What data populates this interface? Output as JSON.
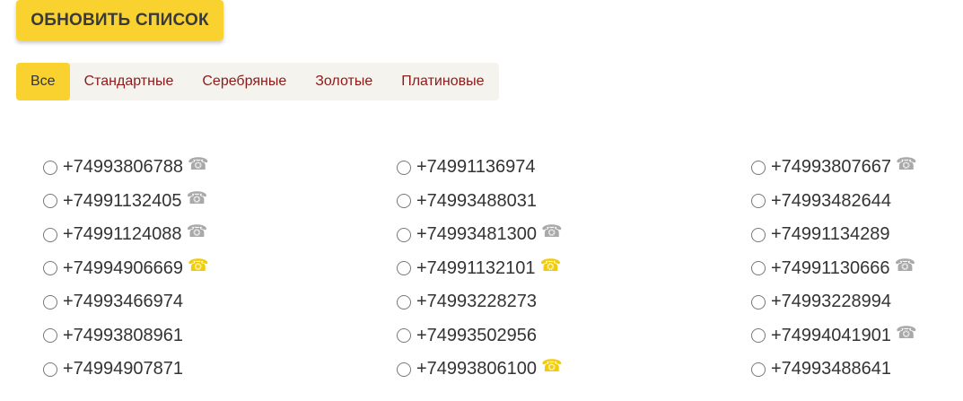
{
  "refresh_button": {
    "label": "ОБНОВИТЬ СПИСОК"
  },
  "tabs": [
    {
      "label": "Все",
      "active": true
    },
    {
      "label": "Стандартные",
      "active": false
    },
    {
      "label": "Серебряные",
      "active": false
    },
    {
      "label": "Золотые",
      "active": false
    },
    {
      "label": "Платиновые",
      "active": false
    }
  ],
  "colors": {
    "accent": "#f9d230",
    "tab_text": "#8b1a1a",
    "icon_gray": "#a9a9a9",
    "icon_gold": "#f2cc0b"
  },
  "icons": {
    "phone": "phone-icon"
  },
  "columns": [
    [
      {
        "number": "+74993806788",
        "icon": "gray"
      },
      {
        "number": "+74991132405",
        "icon": "gray"
      },
      {
        "number": "+74991124088",
        "icon": "gray"
      },
      {
        "number": "+74994906669",
        "icon": "gold"
      },
      {
        "number": "+74993466974",
        "icon": ""
      },
      {
        "number": "+74993808961",
        "icon": ""
      },
      {
        "number": "+74994907871",
        "icon": ""
      }
    ],
    [
      {
        "number": "+74991136974",
        "icon": ""
      },
      {
        "number": "+74993488031",
        "icon": ""
      },
      {
        "number": "+74993481300",
        "icon": "gray"
      },
      {
        "number": "+74991132101",
        "icon": "gold"
      },
      {
        "number": "+74993228273",
        "icon": ""
      },
      {
        "number": "+74993502956",
        "icon": ""
      },
      {
        "number": "+74993806100",
        "icon": "gold"
      }
    ],
    [
      {
        "number": "+74993807667",
        "icon": "gray"
      },
      {
        "number": "+74993482644",
        "icon": ""
      },
      {
        "number": "+74991134289",
        "icon": ""
      },
      {
        "number": "+74991130666",
        "icon": "gray"
      },
      {
        "number": "+74993228994",
        "icon": ""
      },
      {
        "number": "+74994041901",
        "icon": "gray"
      },
      {
        "number": "+74993488641",
        "icon": ""
      }
    ]
  ]
}
